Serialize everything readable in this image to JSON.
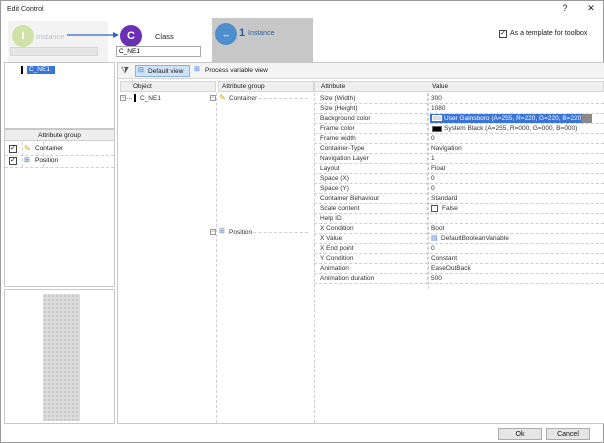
{
  "window": {
    "title": "Edit Control",
    "help": "?",
    "close": "✕"
  },
  "wizard": {
    "step1": {
      "letter": "I",
      "label": "Instance"
    },
    "step2": {
      "letter": "C",
      "label": "Class",
      "value": "C_NE1"
    },
    "step3": {
      "number": "1",
      "label": "Instance"
    }
  },
  "template_checkbox": {
    "checked": "✓",
    "label": "As a template for toolbox"
  },
  "left": {
    "selected_instance": "C_NE1",
    "attribute_group_header": "Attribute group",
    "groups": [
      {
        "check": "✓",
        "label": "Container"
      },
      {
        "check": "✓",
        "label": "Position"
      }
    ]
  },
  "toolbar": {
    "default_view": "Default view",
    "process_view": "Process variable view"
  },
  "columns": {
    "object": "Object",
    "attribute_group": "Attribute group",
    "attribute": "Attribute",
    "value": "Value"
  },
  "tree": {
    "object": "C_NE1",
    "groups": [
      "Container",
      "Position"
    ]
  },
  "rows": [
    {
      "attribute": "Size (Width)",
      "value": "300"
    },
    {
      "attribute": "Size (Height)",
      "value": "1080"
    },
    {
      "attribute": "Background color",
      "value": "User Gainsboro (A=255, R=220, G=220, B=220)"
    },
    {
      "attribute": "Frame color",
      "value": "System Black (A=255, R=000, G=000, B=000)"
    },
    {
      "attribute": "Frame width",
      "value": "0"
    },
    {
      "attribute": "Container-Type",
      "value": "Navigation"
    },
    {
      "attribute": "Navigation Layer",
      "value": "1"
    },
    {
      "attribute": "Layout",
      "value": "Float"
    },
    {
      "attribute": "Space (X)",
      "value": "0"
    },
    {
      "attribute": "Space (Y)",
      "value": "0"
    },
    {
      "attribute": "Container Behaviour",
      "value": "Standard"
    },
    {
      "attribute": "Scale content",
      "value": "False"
    },
    {
      "attribute": "Help ID",
      "value": ""
    },
    {
      "attribute": "X Condition",
      "value": "Bool"
    },
    {
      "attribute": "X Value",
      "value": "DefaultBooleanVariable"
    },
    {
      "attribute": "X End point",
      "value": "0"
    },
    {
      "attribute": "Y Condition",
      "value": "Constant"
    },
    {
      "attribute": "Animation",
      "value": "EaseOutBack"
    },
    {
      "attribute": "Animation duration",
      "value": "500"
    }
  ],
  "buttons": {
    "ok": "Ok",
    "cancel": "Cancel"
  },
  "colors": {
    "wizard_step1": "#cfe3a8",
    "wizard_step2": "#6a2fb3",
    "wizard_step3": "#4d8fcc",
    "selection": "#3a74d6",
    "gainsboro": "#dcdcdc",
    "black": "#000000"
  }
}
